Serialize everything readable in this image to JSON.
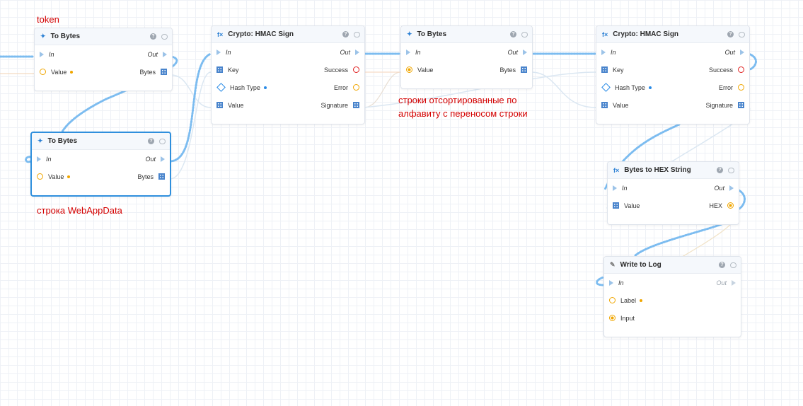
{
  "notes": {
    "token": "token",
    "sorted_line1": "строки отсортированные по",
    "sorted_line2": "алфавиту с переносом строки",
    "webappdata": "строка WebAppData"
  },
  "nodes": {
    "to_bytes_1": {
      "title": "To Bytes",
      "kind_icon": "function-kind-icon",
      "inputs": [
        "In",
        "Value"
      ],
      "outputs": [
        "Out",
        "Bytes"
      ]
    },
    "to_bytes_2": {
      "title": "To Bytes",
      "kind_icon": "function-kind-icon",
      "inputs": [
        "In",
        "Value"
      ],
      "outputs": [
        "Out",
        "Bytes"
      ]
    },
    "hmac_1": {
      "title": "Crypto: HMAC Sign",
      "kind_icon": "fx-icon",
      "inputs": [
        "In",
        "Key",
        "Hash Type",
        "Value"
      ],
      "outputs": [
        "Out",
        "Success",
        "Error",
        "Signature"
      ]
    },
    "to_bytes_3": {
      "title": "To Bytes",
      "kind_icon": "function-kind-icon",
      "inputs": [
        "In",
        "Value"
      ],
      "outputs": [
        "Out",
        "Bytes"
      ]
    },
    "hmac_2": {
      "title": "Crypto: HMAC Sign",
      "kind_icon": "fx-icon",
      "inputs": [
        "In",
        "Key",
        "Hash Type",
        "Value"
      ],
      "outputs": [
        "Out",
        "Success",
        "Error",
        "Signature"
      ]
    },
    "bytes_to_hex": {
      "title": "Bytes to HEX String",
      "kind_icon": "fx-icon",
      "inputs": [
        "In",
        "Value"
      ],
      "outputs": [
        "Out",
        "HEX"
      ]
    },
    "write_log": {
      "title": "Write to Log",
      "kind_icon": "pencil-icon",
      "inputs": [
        "In",
        "Label",
        "Input"
      ],
      "outputs": [
        "Out"
      ]
    }
  },
  "header_buttons": {
    "help": "?",
    "comment": ""
  },
  "colors": {
    "exec_wire": "#7cbcf0",
    "data_wire": "#d9e6f2",
    "selected_border": "#2f8fdd",
    "note_text": "#d40000"
  }
}
